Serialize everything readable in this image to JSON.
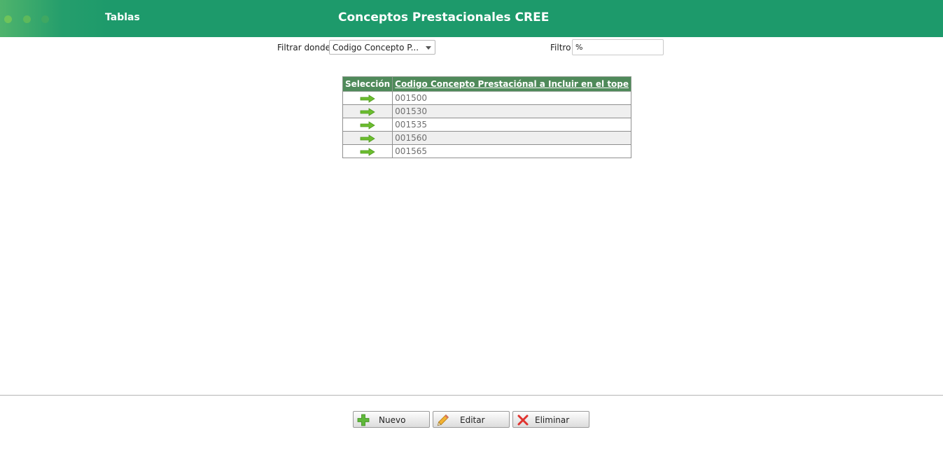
{
  "header": {
    "tab_label": "Tablas",
    "title": "Conceptos Prestacionales CREE",
    "background_color": "#1d9a6b"
  },
  "filter": {
    "where_label": "Filtrar donde",
    "field_selected": "Codigo Concepto P...",
    "filter_label": "Filtro",
    "filter_value": "%"
  },
  "grid": {
    "columns": [
      "Selección",
      "Codigo Concepto Prestaciónal a Incluir en el tope"
    ],
    "header_color": "#4f8a5a",
    "select_icon": "green-arrow-right-icon",
    "rows": [
      {
        "code": "001500"
      },
      {
        "code": "001530"
      },
      {
        "code": "001535"
      },
      {
        "code": "001560"
      },
      {
        "code": "001565"
      }
    ]
  },
  "buttons": {
    "nuevo": {
      "label": "Nuevo",
      "icon": "plus-icon"
    },
    "editar": {
      "label": "Editar",
      "icon": "pencil-icon"
    },
    "eliminar": {
      "label": "Eliminar",
      "icon": "close-icon"
    }
  }
}
